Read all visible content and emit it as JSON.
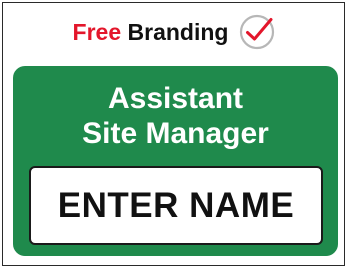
{
  "branding": {
    "free_label": "Free",
    "branding_label": "Branding",
    "icon": "checkmark-circle-icon",
    "free_color": "#e3162b"
  },
  "sign": {
    "title_line1": "Assistant",
    "title_line2": "Site Manager",
    "name_placeholder": "ENTER NAME",
    "background_color": "#1f8a4c",
    "text_color": "#ffffff"
  }
}
